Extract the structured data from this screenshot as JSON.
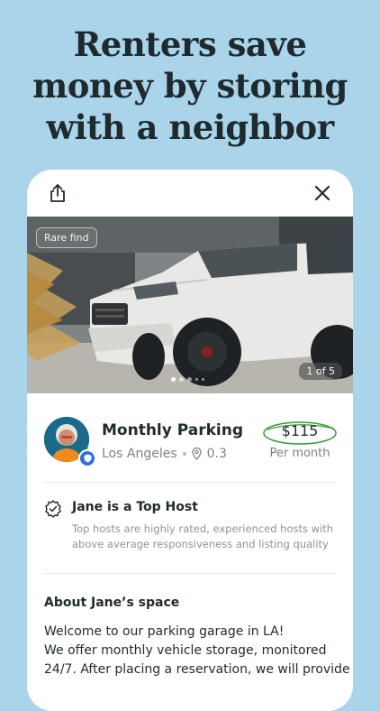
{
  "headline": {
    "line1": "Renters save",
    "line2": "money by storing",
    "line3": "with a neighbor"
  },
  "photo": {
    "badge": "Rare find",
    "counter": "1 of 5",
    "total_dots": 5,
    "active_dot": 1
  },
  "listing": {
    "title": "Monthly Parking",
    "city": "Los Angeles",
    "distance": "0.3",
    "price": "$115",
    "price_unit": "Per month"
  },
  "top_host": {
    "title": "Jane is a Top Host",
    "description": "Top hosts are highly rated, experienced hosts with above average responsiveness and listing quality"
  },
  "about": {
    "title": "About Jane’s space",
    "line1": "Welcome to our parking garage in LA!",
    "line2": "We offer monthly vehicle storage, monitored",
    "line3": "24/7. After placing a reservation, we will provide"
  },
  "icons": {
    "share": "share-icon",
    "close": "close-icon",
    "location": "location-pin-icon",
    "verified": "shield-check-icon",
    "top_host": "award-badge-icon"
  },
  "colors": {
    "background": "#a9d4ea",
    "price_circle": "#3a9a3a",
    "verified_badge": "#2f6fdc"
  }
}
